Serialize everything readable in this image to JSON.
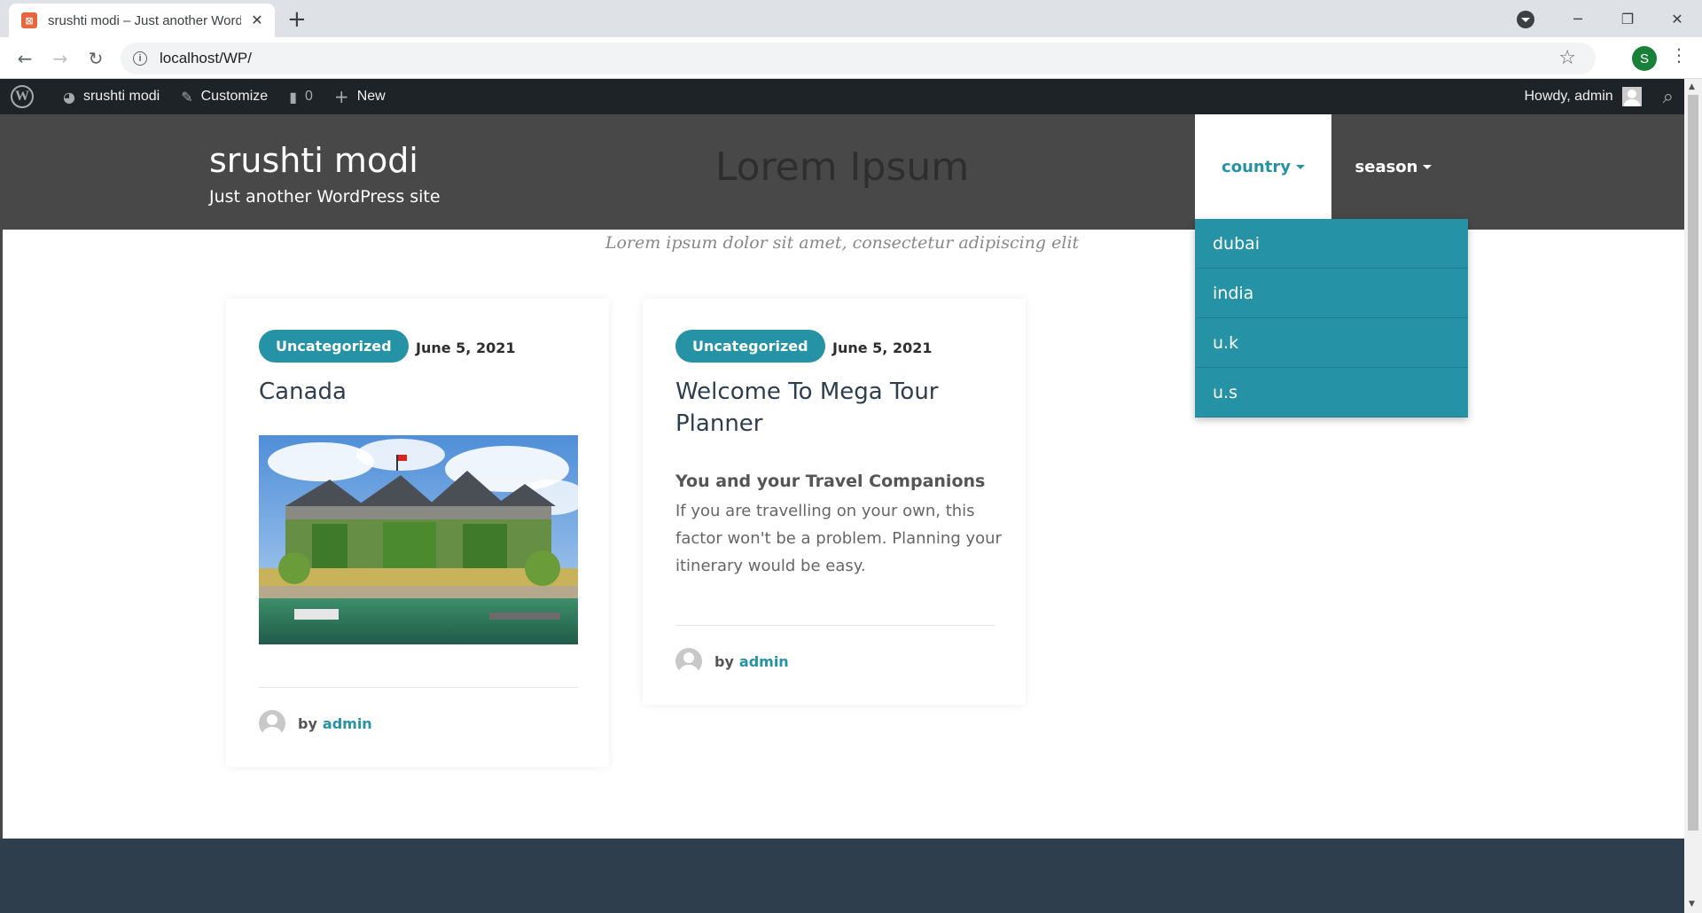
{
  "browser": {
    "tab_title": "srushti modi – Just another Word",
    "tab_close": "✕",
    "new_tab": "+",
    "url": "localhost/WP/",
    "profile_initial": "S",
    "window_controls": {
      "minimize": "─",
      "restore": "❐",
      "close": "✕"
    },
    "nav": {
      "back": "←",
      "forward": "→",
      "reload": "↻"
    },
    "star": "☆",
    "menu": "⋮"
  },
  "adminbar": {
    "wp_logo": "W",
    "site_name": "srushti modi",
    "customize": "Customize",
    "comments_count": "0",
    "new": "New",
    "howdy": "Howdy, admin",
    "search_icon": "⌕"
  },
  "header": {
    "site_title": "srushti modi",
    "tagline": "Just another WordPress site",
    "hero_title": "Lorem Ipsum",
    "hero_subtitle": "Lorem ipsum dolor sit amet, consectetur adipiscing elit"
  },
  "nav": {
    "items": [
      {
        "label": "country"
      },
      {
        "label": "season"
      }
    ],
    "dropdown": [
      "dubai",
      "india",
      "u.k",
      "u.s"
    ]
  },
  "posts": [
    {
      "category": "Uncategorized",
      "date": "June 5, 2021",
      "title": "Canada",
      "by": "by",
      "author": "admin"
    },
    {
      "category": "Uncategorized",
      "date": "June 5, 2021",
      "title": "Welcome To Mega Tour Planner",
      "excerpt_heading": "You and your Travel Companions",
      "excerpt": "If you are travelling on your own, this factor won't be a problem. Planning your itinerary would be easy.",
      "by": "by",
      "author": "admin"
    }
  ],
  "colors": {
    "accent": "#2592a6",
    "header_bg": "#484848",
    "adminbar_bg": "#1d2327",
    "footer_bg": "#2f3e4c"
  }
}
